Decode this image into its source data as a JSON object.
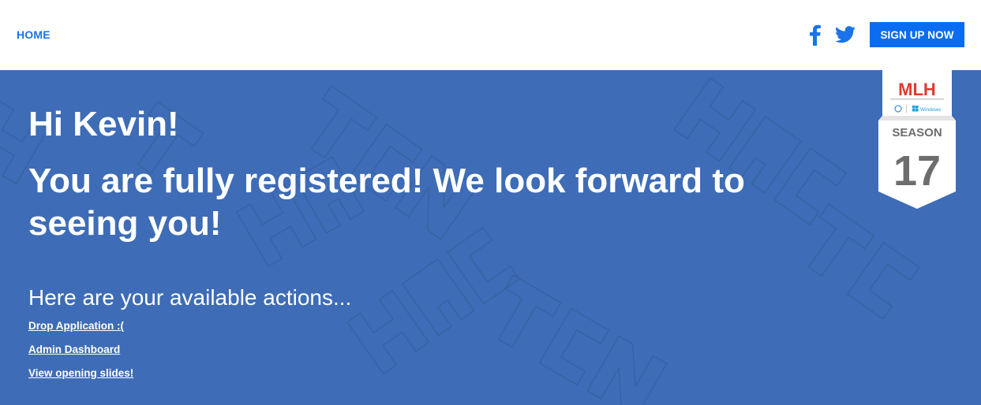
{
  "nav": {
    "home_label": "HOME",
    "social": [
      {
        "icon": "facebook-icon"
      },
      {
        "icon": "twitter-icon"
      }
    ],
    "signup_label": "SIGN UP NOW"
  },
  "hero": {
    "greeting": "Hi Kevin!",
    "message": "You are fully registered! We look forward to seeing you!",
    "actions_heading": "Here are your available actions...",
    "actions": [
      {
        "label": "Drop Application :("
      },
      {
        "label": "Admin Dashboard"
      },
      {
        "label": "View opening slides!"
      }
    ]
  },
  "badge": {
    "logo_text": "MLH",
    "season_label": "SEASON",
    "season_number": "17",
    "sponsor_text": "Windows"
  },
  "colors": {
    "accent": "#0a6cf1",
    "hero_background": "#3e6cb6",
    "link": "#1a73e8"
  }
}
